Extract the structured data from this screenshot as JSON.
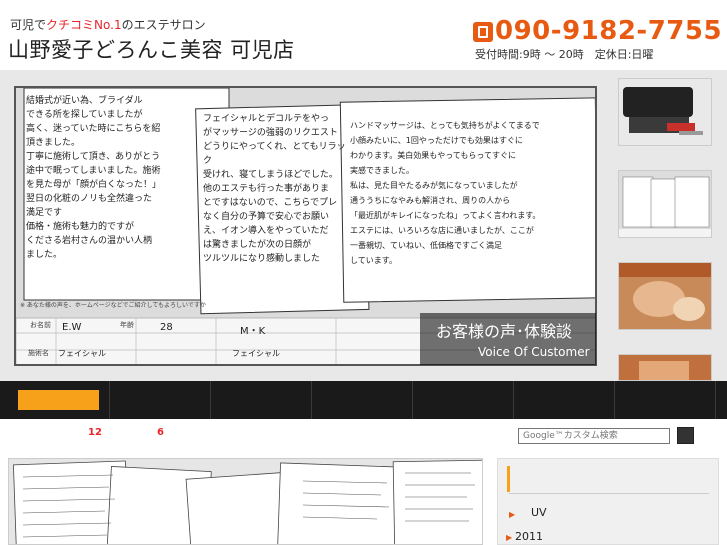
{
  "header": {
    "tagline_pre": "可児で",
    "tagline_highlight": "クチコミNo.1",
    "tagline_post": "のエステサロン",
    "shop_title": "山野愛子どろんこ美容 可児店",
    "phone": "090-9182-7755",
    "hours": "受付時間:9時 ～ 20時　定休日:日曜"
  },
  "slideshow": {
    "caption_jp": "お客様の声･体験談",
    "caption_en": "Voice Of Customer",
    "card1_lines": [
      "結婚式が近い為、ブライダル",
      "できる所を探していましたが",
      "高く、迷っていた時にこちらを紹",
      "頂きました。",
      "丁寧に施術して頂き、ありがとう",
      "途中で眠ってしまいました。施術",
      "を見た母が「顔が白くなった！」",
      "翌日の化粧のノリも全然違った",
      "満足です",
      "価格・施術も魅力的ですが",
      "くださる岩村さんの温かい人柄",
      "ました。"
    ],
    "card2_lines": [
      "フェイシャルとデコルテをやっ",
      "がマッサージの強弱のリクエスト",
      "どうりにやってくれ、とてもリラック",
      "受けれ、寝てしまうほどでした。",
      "他のエステも行った事がありま",
      "とですはないので、こちらでプレ",
      "なく自分の予算で安心でお願い",
      "え、イオン導入をやっていただ",
      "は驚きましたが次の日顔が",
      "ツルツルになり感動しました"
    ],
    "card3_lines": [
      "ハンドマッサージは、とっても気持ちがよくてまるで",
      "小顔みたいに、1回やっただけでも効果はすぐに",
      "わかります。美白効果もやってもらってすぐに",
      "実感できました。",
      "私は、見た目やたるみが気になっていましたが",
      "通ううちになやみも解消され、周りの人から",
      "「最近肌がキレイになったね」ってよく言われます。",
      "エステには、いろいろな店に通いましたが、ここが",
      "一番親切、ていねい、低価格ですごく満足",
      "しています。"
    ],
    "form_note": "※ あなた様の声を、ホームページなどでご紹介してもよろしいですか",
    "form_name_label": "お名前",
    "form_name1": "E.W",
    "form_age_label": "年齢",
    "form_age1": "28",
    "form_name2": "M・K",
    "form_menu_label": "施術名",
    "form_menu1": "フェイシャル",
    "form_menu2": "フェイシャル"
  },
  "nav": {
    "items": [
      "",
      "",
      "",
      "",
      "",
      "",
      "",
      "",
      ""
    ]
  },
  "toolbar": {
    "count_a": "12",
    "count_b": "6",
    "search_placeholder": "Google™カスタム検索"
  },
  "sidebar": {
    "item_uv": "UV",
    "item_year": "2011"
  },
  "colors": {
    "accent_orange": "#f7a11a",
    "phone_orange": "#e85a12",
    "highlight_red": "#e8262a",
    "nav_dark": "#1a1a1a"
  }
}
